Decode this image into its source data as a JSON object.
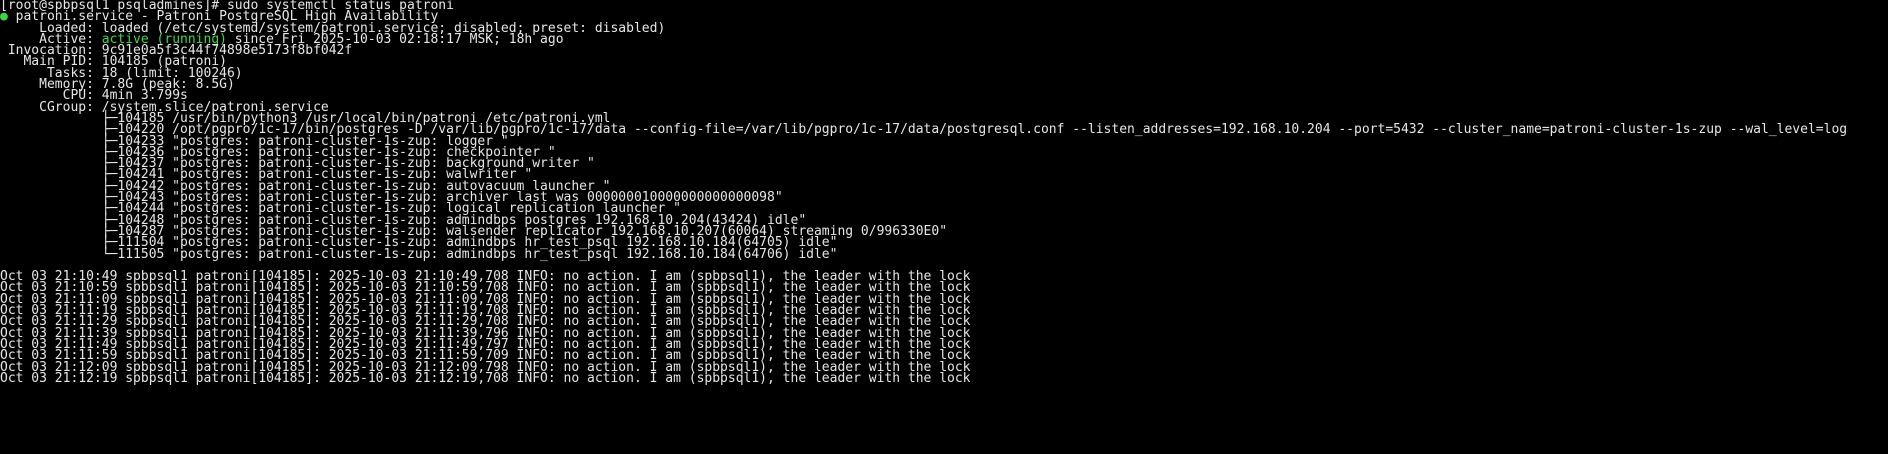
{
  "prompt": "[root@spbpsql1 psqladmines]# sudo systemctl status patroni",
  "colors": {
    "background": "#000000",
    "text": "#e6e6e6",
    "active": "#3fd44a"
  },
  "status": {
    "dot": "●",
    "unit_line": " patroni.service - Patroni PostgreSQL High Availability",
    "loaded_label": "     Loaded: ",
    "loaded_value": "loaded (/etc/systemd/system/patroni.service; disabled; preset: disabled)",
    "active_label": "     Active: ",
    "active_state": "active (running)",
    "active_since": " since Fri 2025-10-03 02:18:17 MSK; 18h ago",
    "invocation_label": " Invocation: ",
    "invocation_value": "9c91e0a5f3c44f74898e5173f8bf042f",
    "mainpid_label": "   Main PID: ",
    "mainpid_value": "104185 (patroni)",
    "tasks_label": "      Tasks: ",
    "tasks_value": "18 (limit: 100246)",
    "memory_label": "     Memory: ",
    "memory_value": "7.8G (peak: 8.5G)",
    "cpu_label": "        CPU: ",
    "cpu_value": "4min 3.799s",
    "cgroup_label": "     CGroup: ",
    "cgroup_value": "/system.slice/patroni.service"
  },
  "processes": [
    "             ├─104185 /usr/bin/python3 /usr/local/bin/patroni /etc/patroni.yml",
    "             ├─104220 /opt/pgpro/1c-17/bin/postgres -D /var/lib/pgpro/1c-17/data --config-file=/var/lib/pgpro/1c-17/data/postgresql.conf --listen_addresses=192.168.10.204 --port=5432 --cluster_name=patroni-cluster-1s-zup --wal_level=log",
    "             ├─104233 \"postgres: patroni-cluster-1s-zup: logger \"",
    "             ├─104236 \"postgres: patroni-cluster-1s-zup: checkpointer \"",
    "             ├─104237 \"postgres: patroni-cluster-1s-zup: background writer \"",
    "             ├─104241 \"postgres: patroni-cluster-1s-zup: walwriter \"",
    "             ├─104242 \"postgres: patroni-cluster-1s-zup: autovacuum launcher \"",
    "             ├─104243 \"postgres: patroni-cluster-1s-zup: archiver last was 000000010000000000000098\"",
    "             ├─104244 \"postgres: patroni-cluster-1s-zup: logical replication launcher \"",
    "             ├─104248 \"postgres: patroni-cluster-1s-zup: admindbps postgres 192.168.10.204(43424) idle\"",
    "             ├─104287 \"postgres: patroni-cluster-1s-zup: walsender replicator 192.168.10.207(60064) streaming 0/996330E0\"",
    "             ├─111504 \"postgres: patroni-cluster-1s-zup: admindbps hr_test_psql 192.168.10.184(64705) idle\"",
    "             └─111505 \"postgres: patroni-cluster-1s-zup: admindbps hr_test_psql 192.168.10.184(64706) idle\""
  ],
  "logs": [
    "Oct 03 21:10:49 spbpsql1 patroni[104185]: 2025-10-03 21:10:49,708 INFO: no action. I am (spbpsql1), the leader with the lock",
    "Oct 03 21:10:59 spbpsql1 patroni[104185]: 2025-10-03 21:10:59,708 INFO: no action. I am (spbpsql1), the leader with the lock",
    "Oct 03 21:11:09 spbpsql1 patroni[104185]: 2025-10-03 21:11:09,708 INFO: no action. I am (spbpsql1), the leader with the lock",
    "Oct 03 21:11:19 spbpsql1 patroni[104185]: 2025-10-03 21:11:19,708 INFO: no action. I am (spbpsql1), the leader with the lock",
    "Oct 03 21:11:29 spbpsql1 patroni[104185]: 2025-10-03 21:11:29,708 INFO: no action. I am (spbpsql1), the leader with the lock",
    "Oct 03 21:11:39 spbpsql1 patroni[104185]: 2025-10-03 21:11:39,796 INFO: no action. I am (spbpsql1), the leader with the lock",
    "Oct 03 21:11:49 spbpsql1 patroni[104185]: 2025-10-03 21:11:49,797 INFO: no action. I am (spbpsql1), the leader with the lock",
    "Oct 03 21:11:59 spbpsql1 patroni[104185]: 2025-10-03 21:11:59,709 INFO: no action. I am (spbpsql1), the leader with the lock",
    "Oct 03 21:12:09 spbpsql1 patroni[104185]: 2025-10-03 21:12:09,798 INFO: no action. I am (spbpsql1), the leader with the lock",
    "Oct 03 21:12:19 spbpsql1 patroni[104185]: 2025-10-03 21:12:19,708 INFO: no action. I am (spbpsql1), the leader with the lock"
  ]
}
